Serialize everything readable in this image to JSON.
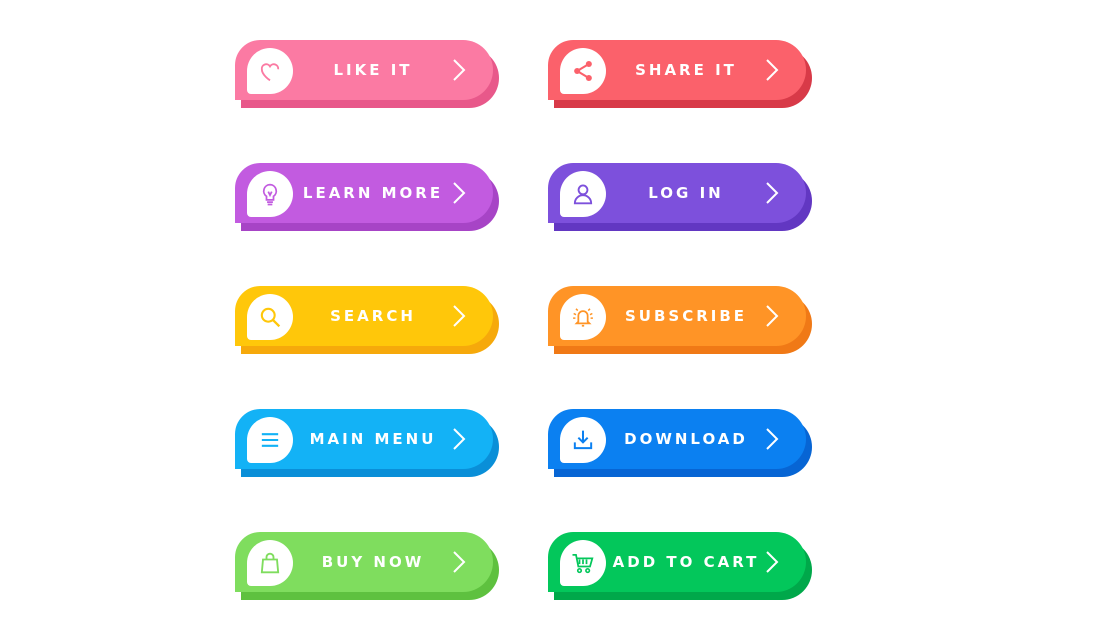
{
  "buttons": [
    {
      "label": "LIKE IT",
      "icon": "heart-icon",
      "color": "#fb7aa3",
      "shadow": "#e8588a"
    },
    {
      "label": "SHARE IT",
      "icon": "share-icon",
      "color": "#fb616b",
      "shadow": "#d83a48"
    },
    {
      "label": "LEARN MORE",
      "icon": "lightbulb-icon",
      "color": "#c25be0",
      "shadow": "#a744c6"
    },
    {
      "label": "LOG IN",
      "icon": "user-icon",
      "color": "#7d50dc",
      "shadow": "#6237c2"
    },
    {
      "label": "SEARCH",
      "icon": "search-icon",
      "color": "#ffc70a",
      "shadow": "#f6a90b"
    },
    {
      "label": "SUBSCRIBE",
      "icon": "bell-icon",
      "color": "#ff9426",
      "shadow": "#f07916"
    },
    {
      "label": "MAIN MENU",
      "icon": "menu-icon",
      "color": "#13b2f6",
      "shadow": "#0a8fd8"
    },
    {
      "label": "DOWNLOAD",
      "icon": "download-icon",
      "color": "#0b80f1",
      "shadow": "#0765d4"
    },
    {
      "label": "BUY NOW",
      "icon": "shopping-bag-icon",
      "color": "#7fdd5e",
      "shadow": "#5ec13f"
    },
    {
      "label": "ADD TO CART",
      "icon": "cart-icon",
      "color": "#03c75b",
      "shadow": "#00a84a"
    }
  ]
}
